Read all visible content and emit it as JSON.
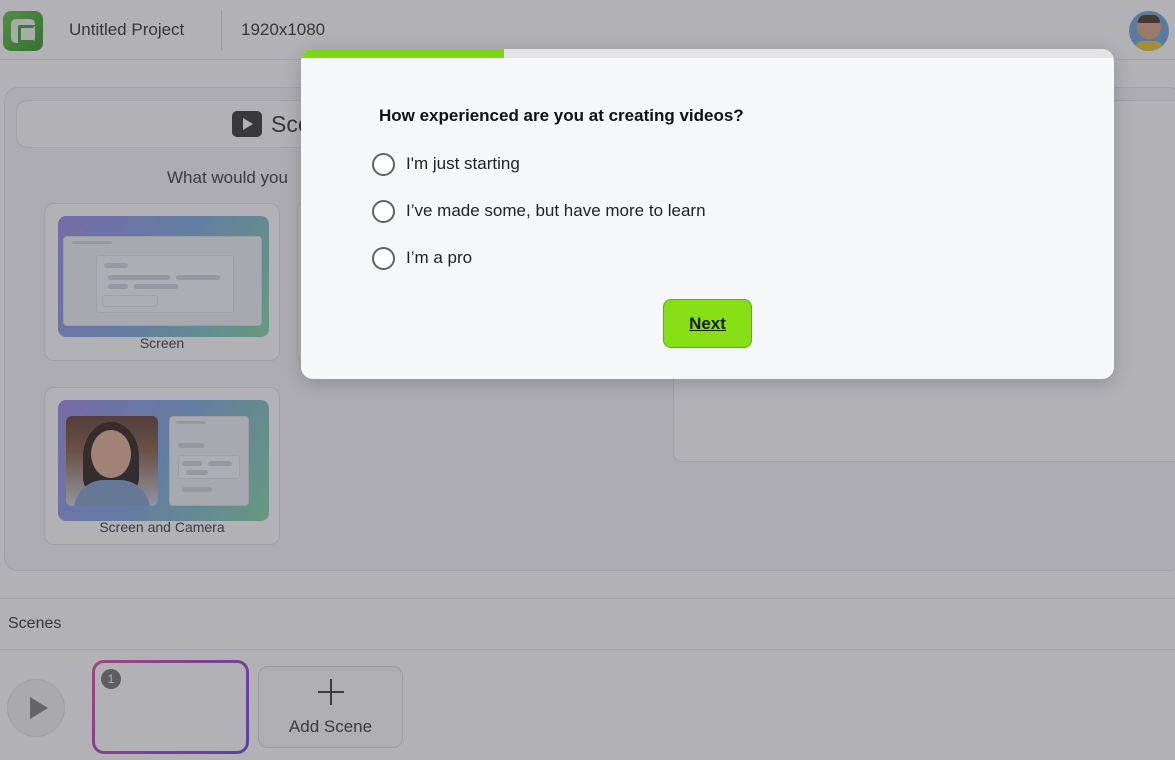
{
  "header": {
    "project_title": "Untitled Project",
    "resolution": "1920x1080",
    "logo_icon": "camtasia-logo-icon",
    "avatar_icon": "user-avatar"
  },
  "scene_panel": {
    "header_text": "Sce",
    "prompt": "What would you",
    "layouts": [
      {
        "label": "Screen"
      },
      {
        "label": "Screen and Camera"
      }
    ]
  },
  "scenes": {
    "label": "Scenes",
    "scene_number": "1",
    "add_scene_label": "Add Scene"
  },
  "modal": {
    "progress": 0.25,
    "question": "How experienced are you at creating videos?",
    "options": [
      {
        "label": "I'm just starting",
        "selected": false
      },
      {
        "label": "I’ve made some, but have more to learn",
        "selected": false
      },
      {
        "label": "I’m a pro",
        "selected": false
      }
    ],
    "next_label": "Next"
  },
  "colors": {
    "accent_green": "#86e015",
    "progress_green": "#7cd617",
    "scene_border_start": "#e0479e",
    "scene_border_end": "#6a3ee0"
  }
}
